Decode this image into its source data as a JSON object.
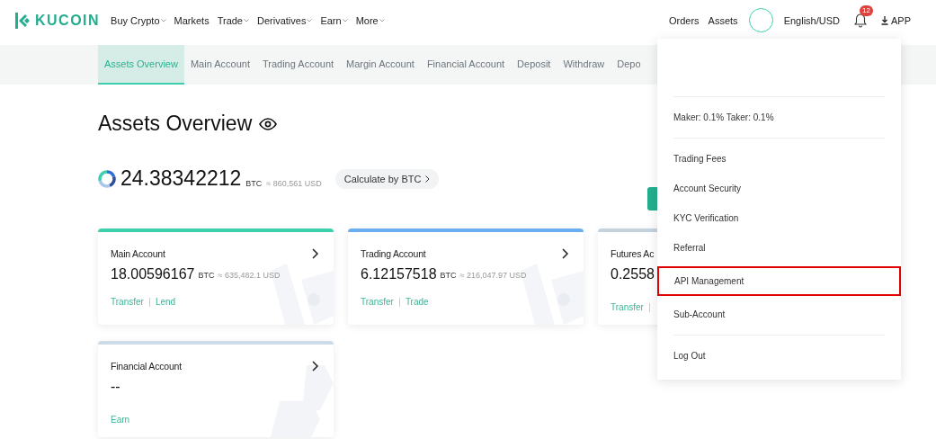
{
  "header": {
    "brand": "KUCOIN",
    "nav": [
      {
        "label": "Buy Crypto",
        "dropdown": true
      },
      {
        "label": "Markets",
        "dropdown": false
      },
      {
        "label": "Trade",
        "dropdown": true
      },
      {
        "label": "Derivatives",
        "dropdown": true
      },
      {
        "label": "Earn",
        "dropdown": true
      },
      {
        "label": "More",
        "dropdown": true
      }
    ],
    "right_links": [
      "Orders",
      "Assets"
    ],
    "language": "English/USD",
    "notification_count": "12",
    "app": "APP"
  },
  "tabs": [
    {
      "label": "Assets Overview",
      "selected": true
    },
    {
      "label": "Main Account",
      "selected": false
    },
    {
      "label": "Trading Account",
      "selected": false
    },
    {
      "label": "Margin Account",
      "selected": false
    },
    {
      "label": "Financial Account",
      "selected": false
    },
    {
      "label": "Deposit",
      "selected": false
    },
    {
      "label": "Withdraw",
      "selected": false
    },
    {
      "label": "Depo",
      "selected": false
    }
  ],
  "title": "Assets Overview",
  "balance": {
    "amount": "24.38342212",
    "unit": "BTC",
    "approx": "≈ 860,561 USD",
    "calc_button": "Calculate by BTC"
  },
  "cards": [
    {
      "name": "Main Account",
      "amount": "18.00596167",
      "unit": "BTC",
      "approx": "≈ 635,482.1 USD",
      "links": [
        "Transfer",
        "Lend"
      ],
      "color": "#3ecfae",
      "chevron": true
    },
    {
      "name": "Trading Account",
      "amount": "6.12157518",
      "unit": "BTC",
      "approx": "≈ 216,047.97 USD",
      "links": [
        "Transfer",
        "Trade"
      ],
      "color": "#6aaef0",
      "chevron": true
    },
    {
      "name": "Futures Ac",
      "amount": "0.2558",
      "links": [
        "Transfer"
      ],
      "color": "#c4d2de"
    },
    {
      "name": "Financial Account",
      "amount": "--",
      "links": [
        "Earn"
      ],
      "color": "#cddbe8",
      "chevron": true
    }
  ],
  "menu": {
    "sections": [
      [
        {
          "label": "Maker: 0.1%  Taker: 0.1%",
          "highlighted": false
        }
      ],
      [
        {
          "label": "Trading Fees",
          "highlighted": false
        },
        {
          "label": "Account Security",
          "highlighted": false
        },
        {
          "label": "KYC Verification",
          "highlighted": false
        },
        {
          "label": "Referral",
          "highlighted": false
        },
        {
          "label": "API Management",
          "highlighted": true
        },
        {
          "label": "Sub-Account",
          "highlighted": false
        }
      ],
      [
        {
          "label": "Log Out",
          "highlighted": false
        }
      ]
    ]
  }
}
